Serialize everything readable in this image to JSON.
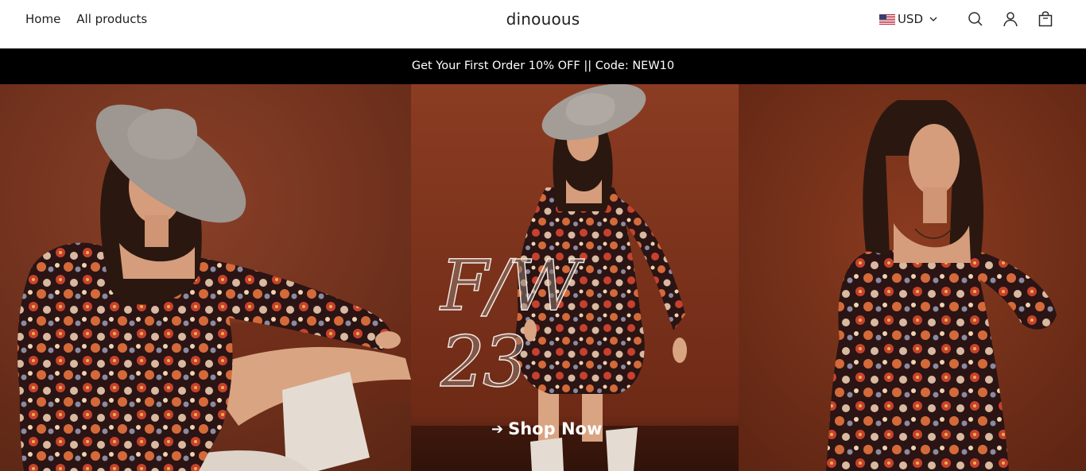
{
  "header": {
    "nav": [
      {
        "label": "Home"
      },
      {
        "label": "All products"
      }
    ],
    "brand": "dinouous",
    "currency": {
      "code": "USD",
      "flag_icon": "us-flag-icon"
    },
    "icons": [
      "search-icon",
      "account-icon",
      "cart-icon"
    ]
  },
  "announcement": {
    "text": "Get Your First Order 10% OFF || Code: NEW10"
  },
  "hero": {
    "title": "F/W 23",
    "cta_label": "Shop Now",
    "cta_icon": "arrow-right-icon"
  },
  "colors": {
    "announcement_bg": "#000000",
    "hero_bg": "#7a3520",
    "text": "#1f1f1f"
  }
}
